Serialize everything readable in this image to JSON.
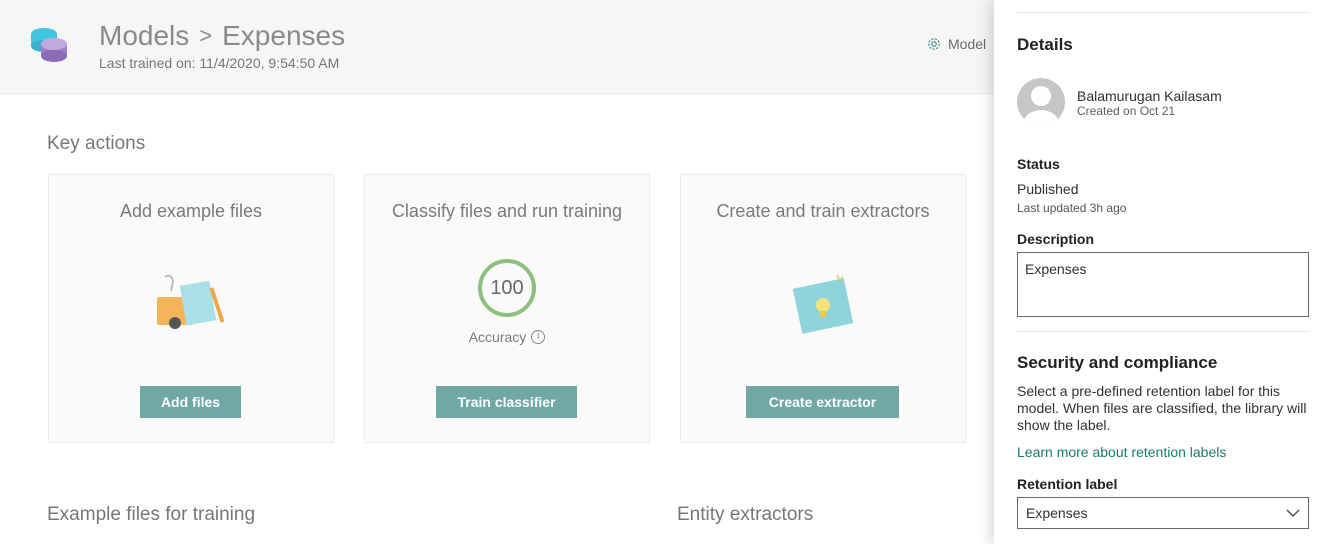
{
  "header": {
    "breadcrumb_root": "Models",
    "breadcrumb_separator": ">",
    "breadcrumb_current": "Expenses",
    "last_trained": "Last trained on: 11/4/2020, 9:54:50 AM",
    "model_settings_label": "Model"
  },
  "key_actions": {
    "title": "Key actions",
    "cards": [
      {
        "title": "Add example files",
        "button": "Add files"
      },
      {
        "title": "Classify files and run training",
        "accuracy_value": "100",
        "accuracy_label": "Accuracy",
        "button": "Train classifier"
      },
      {
        "title": "Create and train extractors",
        "button": "Create extractor"
      }
    ]
  },
  "sections": {
    "example_files": "Example files for training",
    "entity_extractors": "Entity extractors"
  },
  "panel": {
    "details_heading": "Details",
    "person_name": "Balamurugan Kailasam",
    "created": "Created on Oct 21",
    "status_label": "Status",
    "status_value": "Published",
    "last_updated": "Last updated 3h ago",
    "description_label": "Description",
    "description_value": "Expenses",
    "security_heading": "Security and compliance",
    "security_text": "Select a pre-defined retention label for this model. When files are classified, the library will show the label.",
    "learn_more_link": "Learn more about retention labels",
    "retention_label": "Retention label",
    "retention_value": "Expenses"
  },
  "colors": {
    "accent_button": "#6fa8a5",
    "accuracy_ring": "#8fbf80",
    "link": "#1a7a6f"
  },
  "icons": [
    "app-logo-icon",
    "gear-icon",
    "info-icon",
    "avatar-person-icon",
    "chevron-down-icon"
  ]
}
